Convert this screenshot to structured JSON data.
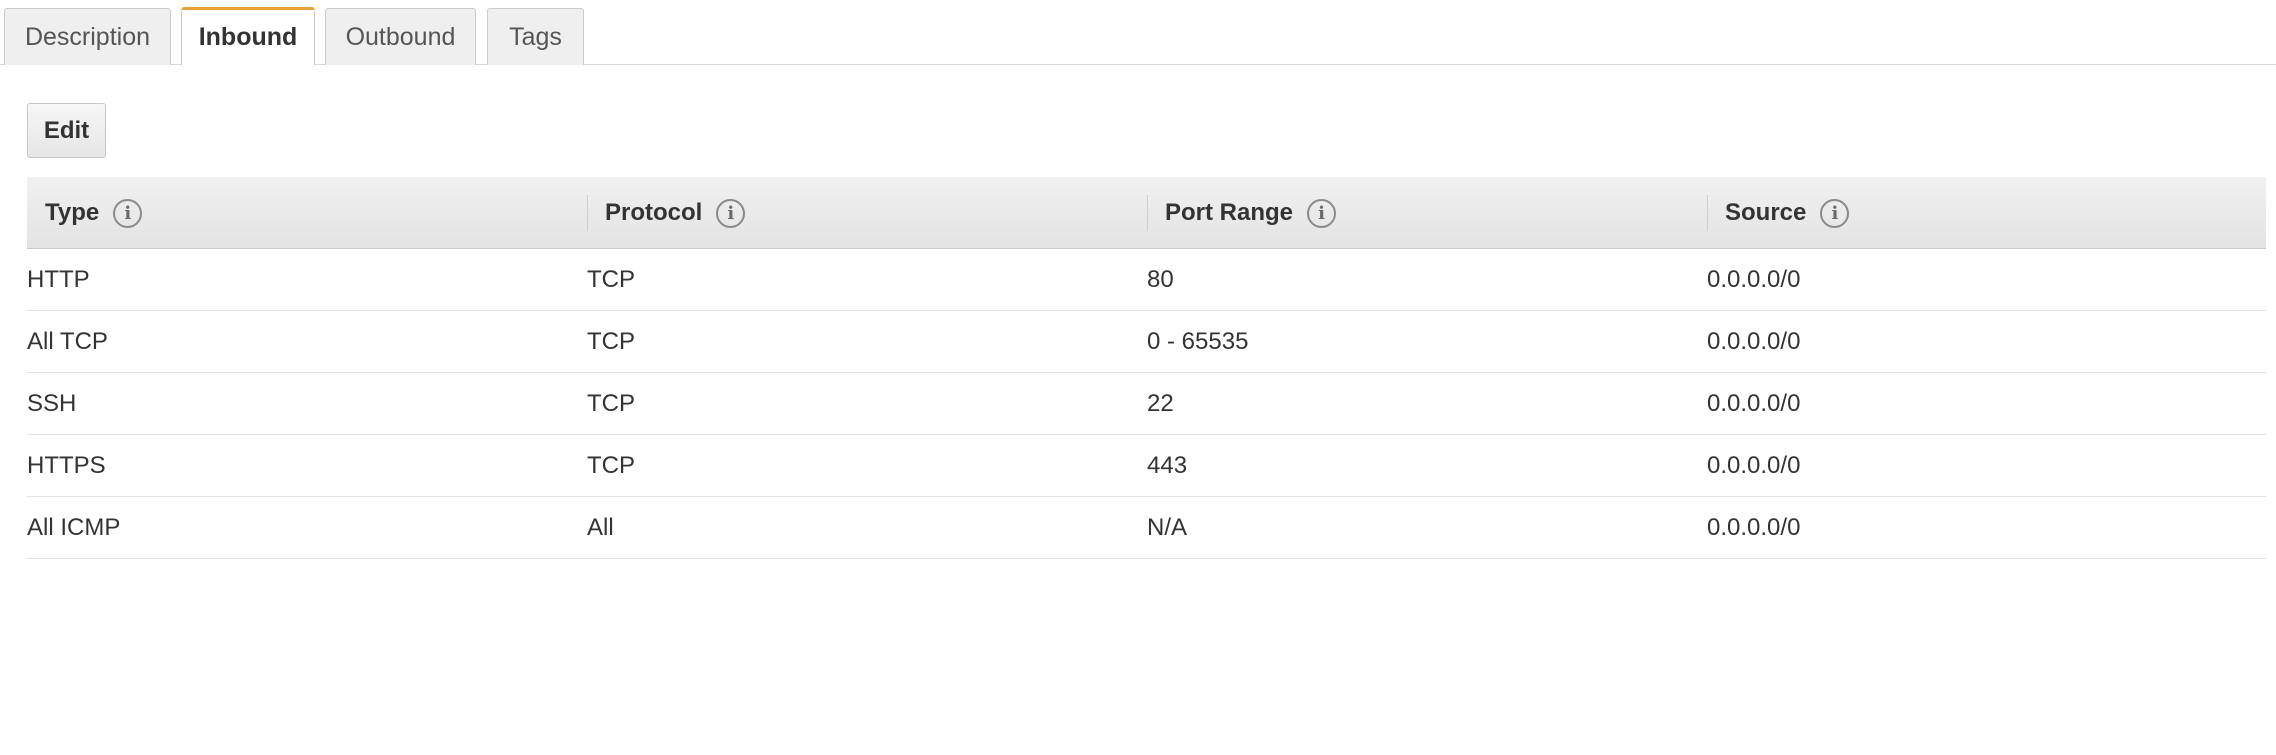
{
  "tabs": [
    {
      "label": "Description",
      "active": false
    },
    {
      "label": "Inbound",
      "active": true
    },
    {
      "label": "Outbound",
      "active": false
    },
    {
      "label": "Tags",
      "active": false
    }
  ],
  "toolbar": {
    "edit_label": "Edit"
  },
  "table": {
    "columns": [
      "Type",
      "Protocol",
      "Port Range",
      "Source"
    ],
    "info_glyph": "i",
    "rows": [
      [
        "HTTP",
        "TCP",
        "80",
        "0.0.0.0/0"
      ],
      [
        "All TCP",
        "TCP",
        "0 - 65535",
        "0.0.0.0/0"
      ],
      [
        "SSH",
        "TCP",
        "22",
        "0.0.0.0/0"
      ],
      [
        "HTTPS",
        "TCP",
        "443",
        "0.0.0.0/0"
      ],
      [
        "All ICMP",
        "All",
        "N/A",
        "0.0.0.0/0"
      ]
    ]
  },
  "colors": {
    "active_tab_accent": "#e7a23a"
  }
}
